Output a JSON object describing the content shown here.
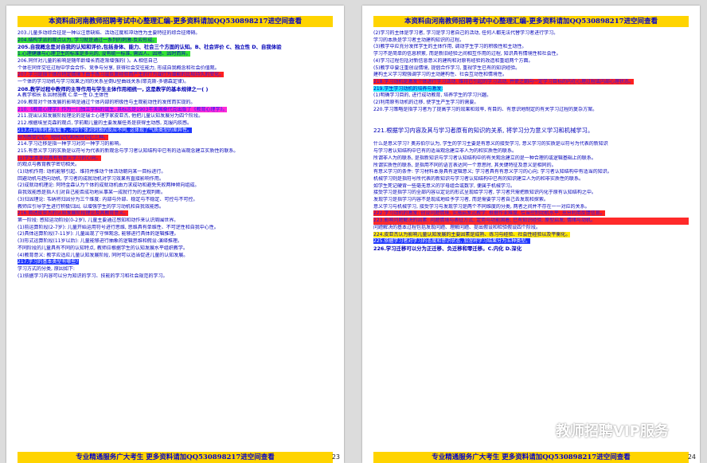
{
  "left_page": {
    "banner_top": "本资料由河南教师招聘考试中心整理汇编-更多资料请加QQ530898217进空间查看",
    "banner_bottom": "专业精通服务广大考生 更多资料请加QQ530898217进空间查看",
    "page_number": "23",
    "lines": [
      {
        "t": "203.儿童多动综合征是一种以注意缺陷、活动过度和冲动性为主要特征的综合征障碍。"
      },
      {
        "t": "204.结构学派的观点认为, 学习就是通过一系列的刺激-反应形成。",
        "hl": "green"
      },
      {
        "t": "205.自我概念是对自我的认知和评价,包括身体、能力、社会三个方面的认知。B、社会评价 C、独立性 D、自我体验",
        "cls": "b"
      },
      {
        "t": "1.心理健康与心理卫生的标准是多元的, 没有统一标准, 需因人、因地、因时而异。",
        "hl": "green"
      },
      {
        "t": "206.同伴对儿童的影响是随年龄增长而逐渐增强的( )。A.相信自己"
      },
      {
        "t": "个体在同伴交往过程中学会合作、竞争与分享, 获得社会交往能力, 形成自我概念和社会价值观。"
      },
      {
        "t": "207.学习是指个体在特定情境下由于练习或反复经验而产生的行为或行为潜能的比较持久的变化。",
        "hl": "red"
      },
      {
        "t": "一个体的学习动机与学习效果之间的关系呈倒U型曲线关系(耶克斯-多德森定律)。"
      },
      {
        "t": "208.教学过程中教师的主导作用与学生主体作用相统一, 这是教学的基本规律之一( )",
        "cls": "b"
      },
      {
        "t": "A.教学相长 B.因材施教 C.单一性 D.主体性"
      },
      {
        "t": "209.教育对个体发展的影响是通过个体内部的积极性与主观能动性的发挥而实现的。"
      },
      {
        "t": "210.《教育心理学》作为一门独立学科的诞生, 其标志是1903年美国桑代克出版了《教育心理学》。",
        "hl": "mag"
      },
      {
        "t": "211.提出认知发展阶段理论的是瑞士心理学家皮亚杰, 他把儿童认知发展分为四个阶段。"
      },
      {
        "t": "212.根据埃里克森的观点, 学前期儿童的主要发展任务是获得主动感, 克服内疚感。"
      },
      {
        "t": "213.在同等刺激强度下, 不同个体对刺激的反应不同, 这体现了气质类型的差异性。",
        "hl": "blue"
      },
      {
        "t": "分为感觉记忆、短时记忆和长时记忆三种。",
        "hl": "red"
      },
      {
        "t": "214.学习迁移是指一种学习对另一种学习的影响。"
      },
      {
        "t": "215.有意义学习的实质是以符号为代表的新观念与学习者认知结构中已有的适当观念建立实质性的联系。"
      },
      {
        "t": "(1)学生本身应具有有意义学习的心向。",
        "hl": "red"
      },
      {
        "t": "的观点与教育教学密切相关。"
      },
      {
        "t": "(1)动机作用: 动机能够引起、维持并推动个体活动朝向某一目标进行。"
      },
      {
        "t": "回避动机与趋向动机, 学习者的成就动机对学习效果有直接影响作用。"
      },
      {
        "t": "(2)成就动机理论: 阿特金森认为个体的成就动机由力求成功和避免失败两种倾向组成。"
      },
      {
        "t": "自我效能感是指人们对自己能否成功地从事某一成就行为的主观判断。"
      },
      {
        "t": "(3)归因理论: 韦纳将归因分为三个维度: 内部与外部、稳定与不稳定、可控与不可控。"
      },
      {
        "t": "教师应引导学生进行积极归因, 以增强学生的学习动机和自我效能感。"
      },
      {
        "t": "216.简述皮亚杰的认知发展阶段理论及其教育意义。",
        "hl": "red"
      },
      {
        "t": "第一阶段: 感知运动阶段(0-2岁), 儿童主要通过感知和动作来认识周围世界。"
      },
      {
        "t": "(1)前运算阶段(2-7岁): 儿童开始运用符号进行思维, 思维具有单维性、不可逆性和自我中心性。"
      },
      {
        "t": "(2)具体运算阶段(7-11岁): 儿童出现了守恒观念, 能够进行具体的逻辑推理。"
      },
      {
        "t": "(3)形式运算阶段(11岁以后): 儿童能够进行抽象的逻辑思维和假设-演绎推理。"
      },
      {
        "t": "不同阶段的儿童具有不同的认知特点, 教师应根据学生的认知发展水平组织教学。"
      },
      {
        "t": "(4)教育意义: 教学应适应儿童认知发展阶段, 同时可以适当促进儿童的认知发展。"
      },
      {
        "t": "217.学习的基本类型有哪些?",
        "hl": "blue"
      },
      {
        "t": "学习方式的分类, 原因如下:"
      },
      {
        "t": "(1)依据学习内容可以分为知识的学习、技能的学习和社会规范的学习。"
      }
    ]
  },
  "right_page": {
    "banner_top": "本资料由河南教师招聘考试中心整理汇编-更多资料请加QQ530898217进空间查看",
    "banner_bottom": "专业精通服务广大考生 更多资料请加QQ530898217进空间查看",
    "page_number": "24",
    "lines": [
      {
        "t": "(2)学习的主体是学习者, 学习是学习者自己的活动, 任何人都无法代替学习者进行学习。"
      },
      {
        "t": "学习的本质是学习者主动建构知识的过程。"
      },
      {
        "t": "(3)教学中应充分发挥学生的主体作用, 调动学生学习的积极性和主动性。"
      },
      {
        "t": "学习不是简单的信息积累, 而是新旧经验之间相互作用的过程, 知识具有情境性和社会性。"
      },
      {
        "t": "(4)学习过程包括对新信息意义的建构和对原有经验的改造和重组两个方面。"
      },
      {
        "t": "(5)教学中要注重创设情境, 提倡合作学习, 重视学生已有的知识经验。"
      },
      {
        "t": "建构主义学习观强调学习的主动建构性、社会互动性和情境性。"
      },
      {
        "t": "218.学习动机是激发个体进行学习活动, 维持已引起的学习活动, 并使之朝向一定学习目标的内在心理过程或内部心理状态。",
        "hl": "red"
      },
      {
        "t": "219.学生学习动机的培养与激发:",
        "hl": "cyan"
      },
      {
        "t": "(1)明确学习目的, 进行成功教育, 培养学生的学习兴趣。"
      },
      {
        "t": "(2)利用原有动机的迁移, 使学生产生学习的需要。"
      },
      {
        "t": "220.学习策略是指学习者为了提高学习的效果和效率, 有目的、有意识地制定的有关学习过程的复杂方案。"
      },
      {
        "t": "221.根据学习内容及其与学习者原有的知识的关系, 将学习分为意义学习和机械学习。",
        "cls": "big gapl"
      },
      {
        "t": "什么是意义学习? 奥苏伯尔认为, 学生的学习主要是有意义的接受学习, 意义学习的实质是以符号为代表的新知识",
        "cls": "gap"
      },
      {
        "t": "与学习者认知结构中已有的适当观念建立非人为的和实质性的联系。"
      },
      {
        "t": "所谓非人为的联系, 是指新知识与学习者认知结构中的有关观念建立的是一种合理的或逻辑基础上的联系。"
      },
      {
        "t": "所谓实质性的联系, 是指用不同的语言表达同一个意思时, 其关键特征及意义是相同的。"
      },
      {
        "t": "有意义学习的条件: 学习材料本身具有逻辑意义; 学习者具有有意义学习的心向; 学习者认知结构中有适当的知识。"
      },
      {
        "t": "机械学习则是指符号所代表的新知识与学习者认知结构中已有的知识建立人为的和非实质性的联系。"
      },
      {
        "t": "如学生死记硬背一些毫无意义的字母组合或数字, 便属于机械学习。"
      },
      {
        "t": "接受学习是指学习的全部内容以定论的形式呈现给学习者, 学习者只需把新知识内化于原有认知结构之中。"
      },
      {
        "t": "发现学习是指学习内容不是现成地给予学习者, 而是需要学习者自己去发现和探索。"
      },
      {
        "t": "意义学习与机械学习, 接受学习与发现学习是两个不同维度的分类, 两者之间并不存在一一对应的关系。"
      },
      {
        "t": "222.学习动机的激发: 创设问题情境, 实施启发式教学; 根据作业难度, 恰当控制动机水平; 充分利用反馈信息。",
        "hl": "red"
      },
      {
        "t": "223.影响问题解决的因素: 问题情境与表征方式; 定势与功能固着; 已有知识经验; 原型启发; 情绪与动机。",
        "cls": "blkred"
      },
      {
        "t": "问题解决的基本过程包括发现问题、理解问题、提出假设和检验假设四个阶段。"
      },
      {
        "t": "224.皮亚杰认为影响儿童认知发展的主要因素是成熟、练习与经验、社会性经验以及平衡化。",
        "hl": "yel"
      },
      {
        "t": "225.依据学习者对学习的态度和意识状态, 加涅将学习结果分为五种类型。",
        "hl": "blue"
      },
      {
        "t": "226.学习迁移可以分为正迁移、负迁移和零迁移。C.内化 D.深化",
        "cls": "b"
      }
    ]
  },
  "watermark": {
    "label": "教师招聘VIP服务",
    "icon": "wechat-icon"
  }
}
